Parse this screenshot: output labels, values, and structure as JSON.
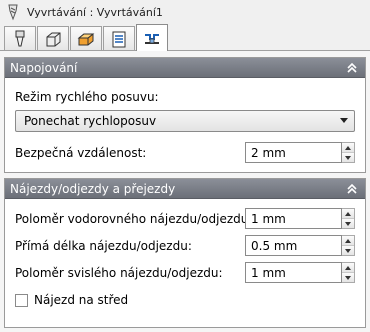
{
  "window": {
    "title": "Vyvrtávání : Vyvrtávání1",
    "icon": "drill-icon"
  },
  "tabs": [
    {
      "icon": "tool-icon",
      "active": false
    },
    {
      "icon": "geometry-icon",
      "active": false
    },
    {
      "icon": "heights-icon",
      "active": false
    },
    {
      "icon": "parameters-icon",
      "active": false
    },
    {
      "icon": "linking-icon",
      "active": true
    }
  ],
  "linking": {
    "header": "Napojování",
    "rapid_mode_label": "Režim rychlého posuvu:",
    "rapid_mode_value": "Ponechat rychloposuv",
    "safe_distance_label": "Bezpečná vzdálenost:",
    "safe_distance_value": "2 mm"
  },
  "leads": {
    "header": "Nájezdy/odjezdy a přejezdy",
    "horizontal_radius_label": "Poloměr vodorovného nájezdu/odjezdu:",
    "horizontal_radius_value": "1 mm",
    "linear_length_label": "Přímá délka nájezdu/odjezdu:",
    "linear_length_value": "0.5 mm",
    "vertical_radius_label": "Poloměr svislého nájezdu/odjezdu:",
    "vertical_radius_value": "1 mm",
    "lead_to_center_label": "Nájezd na střed",
    "lead_to_center_checked": false
  },
  "colors": {
    "panel_header": "#7b7f88",
    "accent": "#1a5fb4"
  }
}
